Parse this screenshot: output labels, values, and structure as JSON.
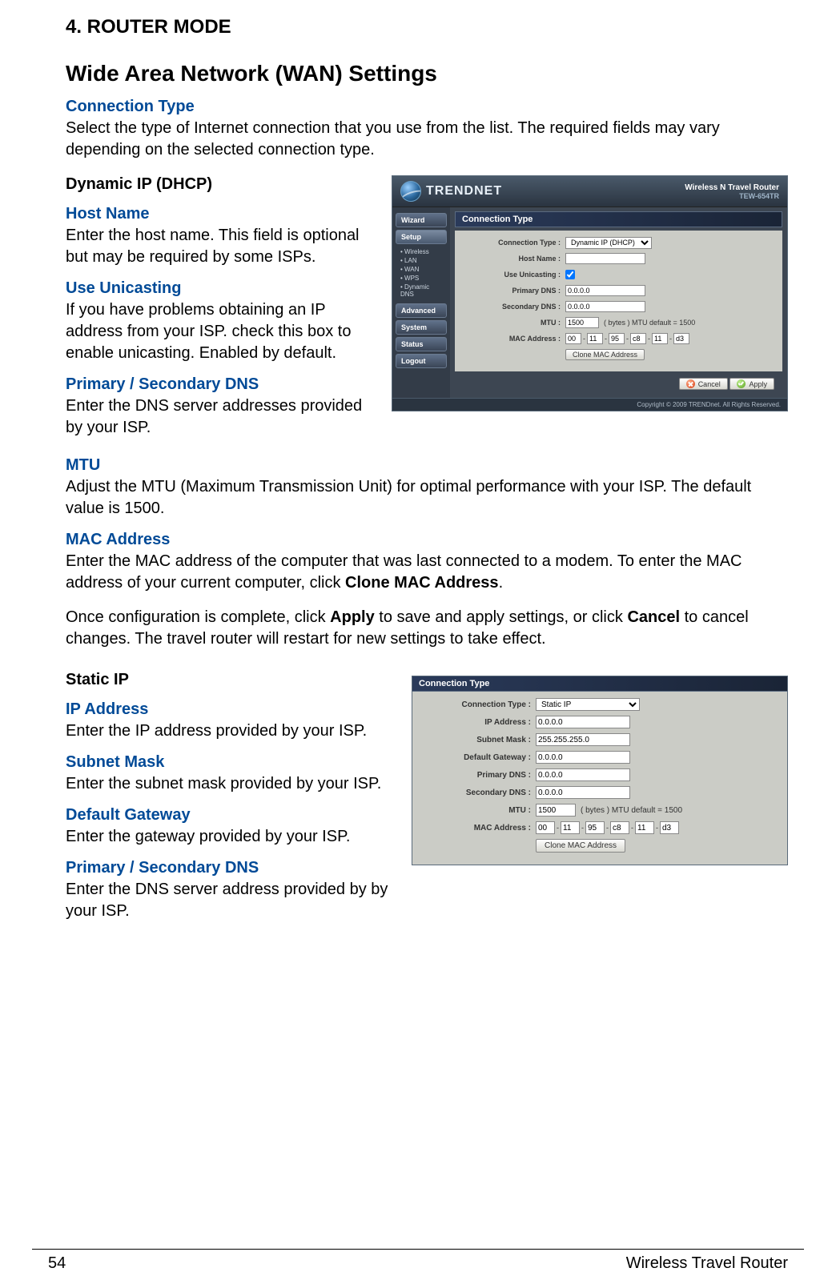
{
  "chapter": "4.  ROUTER MODE",
  "section_title": "Wide Area Network (WAN) Settings",
  "conn_type_heading": "Connection Type",
  "conn_type_body": "Select the type of Internet connection that you use from the list. The required fields may vary depending on the selected connection type.",
  "dyn": {
    "heading": "Dynamic IP (DHCP)",
    "host_h": "Host Name",
    "host_b": "Enter the host name. This field is optional but may be required by some ISPs.",
    "uni_h": "Use Unicasting",
    "uni_b": "If you have problems obtaining an IP address from your ISP. check this box to enable unicasting. Enabled by default.",
    "dns_h": "Primary / Secondary DNS",
    "dns_b": "Enter the DNS server addresses provided by your ISP.",
    "mtu_h": "MTU",
    "mtu_b": "Adjust the MTU (Maximum Transmission Unit) for optimal performance with your ISP. The default value is 1500.",
    "mac_h": "MAC Address",
    "mac_b_1": "Enter the MAC address of the computer that was last connected to a modem. To enter the MAC address of your current computer, click ",
    "mac_b_bold": "Clone MAC Address",
    "mac_b_2": ".",
    "apply_1": "Once configuration is complete, click ",
    "apply_b1": "Apply",
    "apply_2": " to save and apply settings, or click ",
    "apply_b2": "Cancel",
    "apply_3": " to cancel changes. The travel router will restart for new settings to take effect."
  },
  "static": {
    "heading": "Static IP",
    "ip_h": "IP Address",
    "ip_b": "Enter the IP address provided by your ISP.",
    "mask_h": "Subnet Mask",
    "mask_b": "Enter the subnet mask provided by your ISP.",
    "gw_h": "Default Gateway",
    "gw_b": "Enter the gateway provided by your ISP.",
    "dns_h": "Primary / Secondary DNS",
    "dns_b": "Enter the DNS server address provided by by your ISP."
  },
  "shot1": {
    "brand": "TRENDNET",
    "model_line1": "Wireless N Travel Router",
    "model_line2": "TEW-654TR",
    "nav": {
      "wizard": "Wizard",
      "setup": "Setup",
      "items": [
        "Wireless",
        "LAN",
        "WAN",
        "WPS",
        "Dynamic DNS"
      ],
      "advanced": "Advanced",
      "system": "System",
      "status": "Status",
      "logout": "Logout"
    },
    "panel_title": "Connection Type",
    "labels": {
      "conn": "Connection Type :",
      "host": "Host Name :",
      "uni": "Use Unicasting :",
      "pdns": "Primary DNS :",
      "sdns": "Secondary DNS :",
      "mtu": "MTU :",
      "mac": "MAC Address :"
    },
    "values": {
      "conn_sel": "Dynamic IP (DHCP)",
      "host": "",
      "pdns": "0.0.0.0",
      "sdns": "0.0.0.0",
      "mtu": "1500",
      "mtu_hint": "( bytes ) MTU default = 1500",
      "mac": [
        "00",
        "11",
        "95",
        "c8",
        "11",
        "d3"
      ],
      "clone": "Clone MAC Address",
      "cancel": "Cancel",
      "apply": "Apply"
    },
    "copyright": "Copyright © 2009 TRENDnet. All Rights Reserved."
  },
  "shot2": {
    "panel_title": "Connection Type",
    "labels": {
      "conn": "Connection Type :",
      "ip": "IP Address :",
      "mask": "Subnet Mask :",
      "gw": "Default Gateway :",
      "pdns": "Primary DNS :",
      "sdns": "Secondary DNS :",
      "mtu": "MTU :",
      "mac": "MAC Address :"
    },
    "values": {
      "conn_sel": "Static IP",
      "ip": "0.0.0.0",
      "mask": "255.255.255.0",
      "gw": "0.0.0.0",
      "pdns": "0.0.0.0",
      "sdns": "0.0.0.0",
      "mtu": "1500",
      "mtu_hint": "( bytes ) MTU default = 1500",
      "mac": [
        "00",
        "11",
        "95",
        "c8",
        "11",
        "d3"
      ],
      "clone": "Clone MAC Address"
    }
  },
  "footer": {
    "page": "54",
    "title": "Wireless Travel Router"
  }
}
